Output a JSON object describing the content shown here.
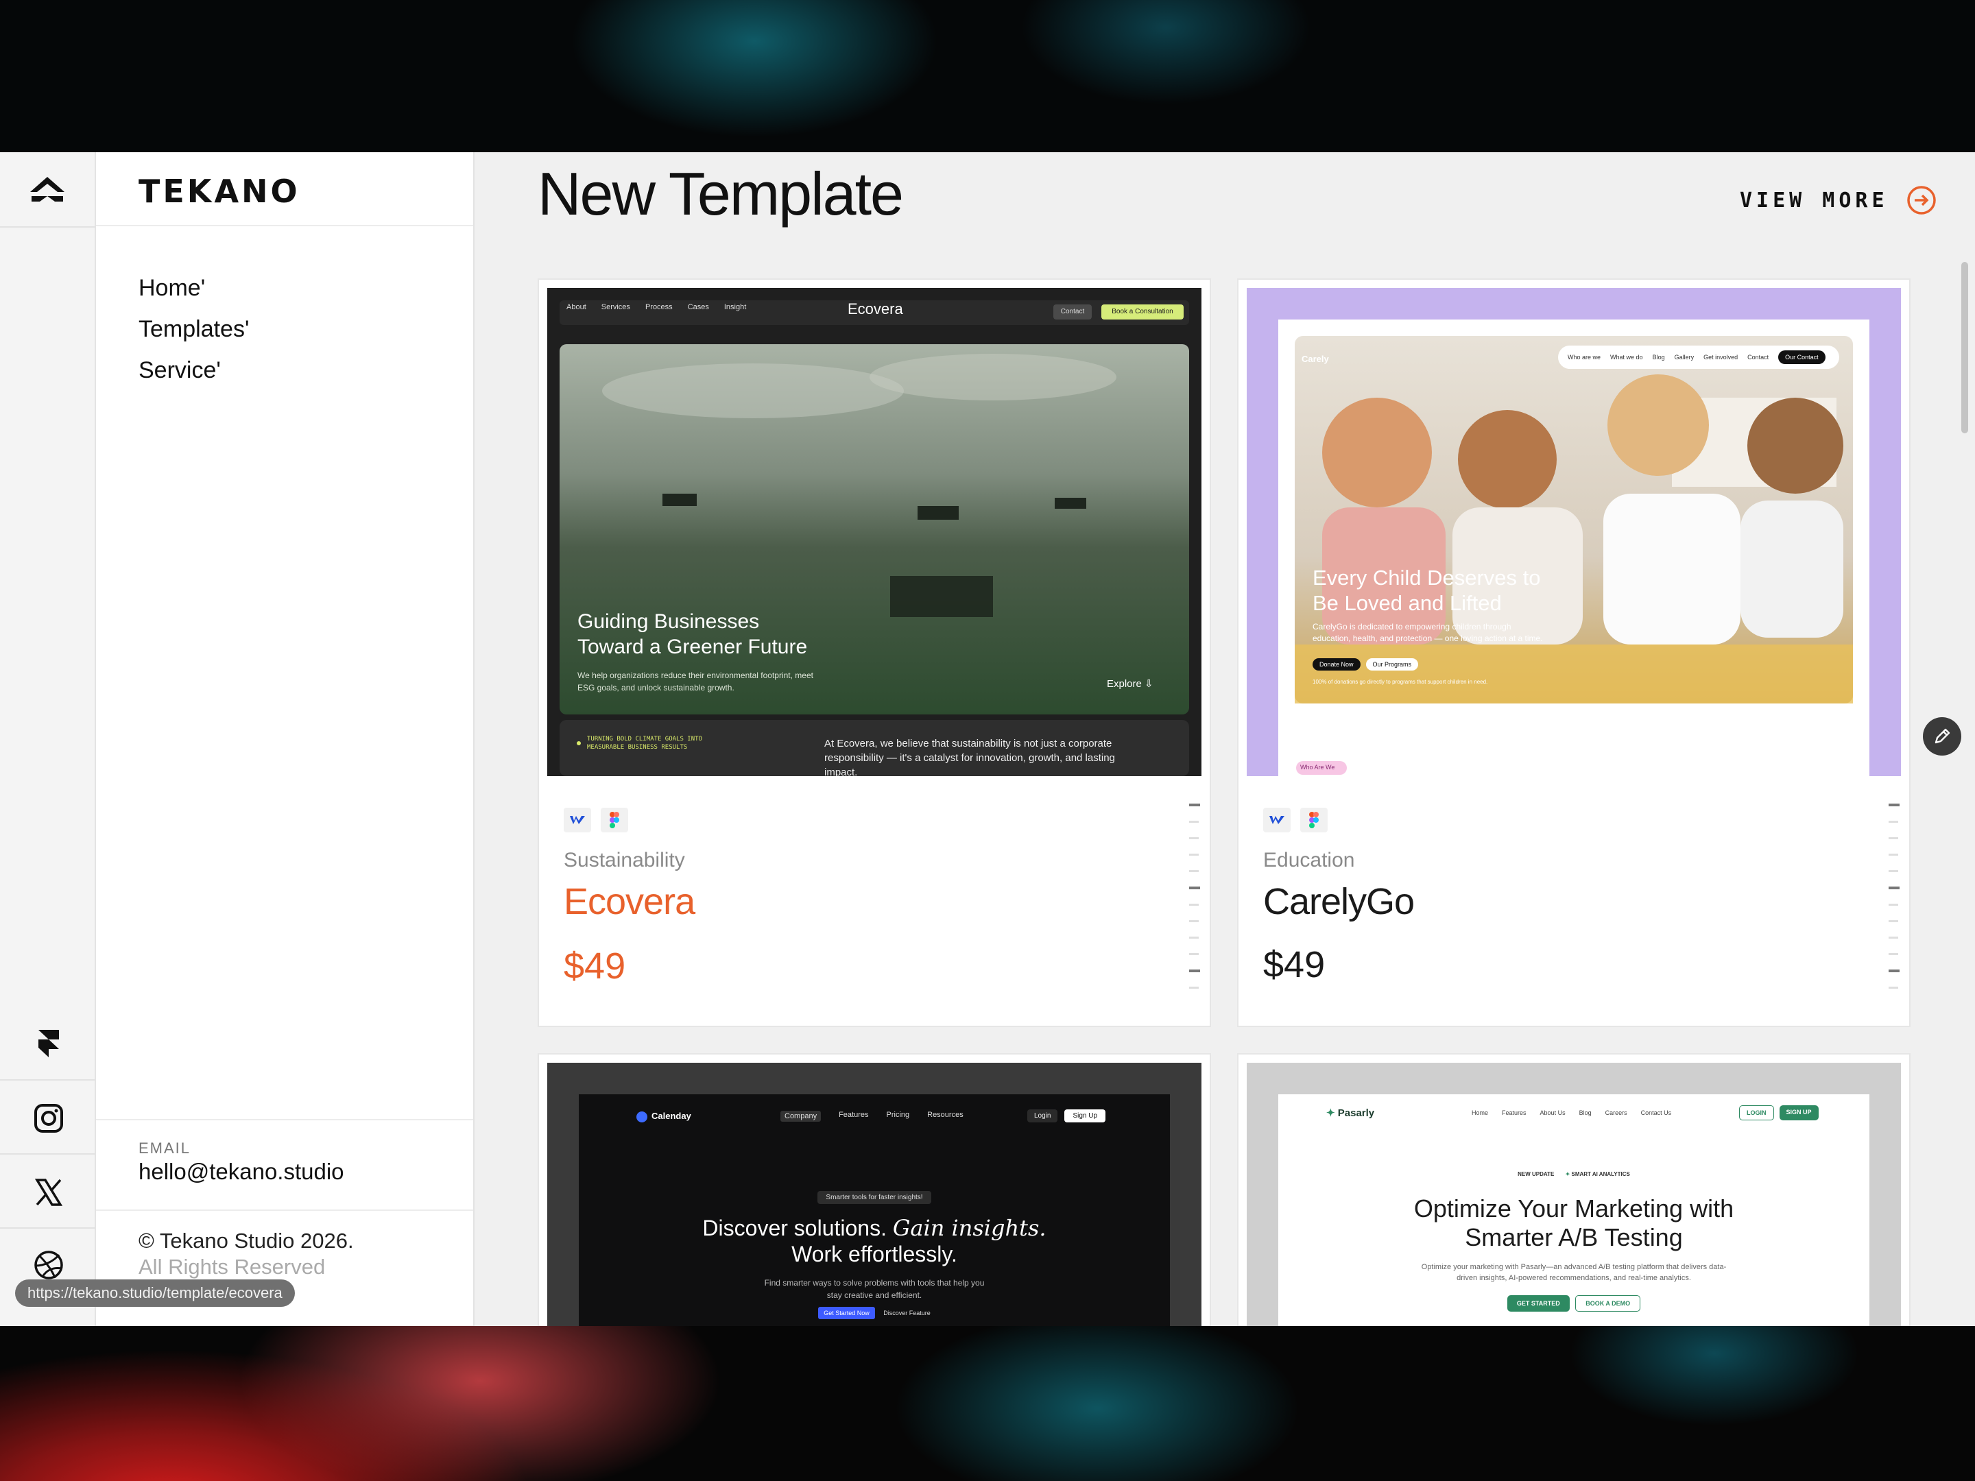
{
  "brand": {
    "name": "TEKANO"
  },
  "nav": [
    {
      "label": "Home'"
    },
    {
      "label": "Templates'"
    },
    {
      "label": "Service'"
    }
  ],
  "footer": {
    "email_label": "EMAIL",
    "email": "hello@tekano.studio",
    "copyright_line1": "© Tekano Studio 2026.",
    "copyright_line2": "All Rights Reserved"
  },
  "rail_icons": [
    "tekano-logo-icon",
    "framer-icon",
    "instagram-icon",
    "x-icon",
    "dribbble-icon"
  ],
  "main": {
    "title": "New Template",
    "view_more": "VIEW MORE"
  },
  "colors": {
    "accent": "#e8612c",
    "ecovera_green": "#2f4a33",
    "carelygo_lilac": "#c5b3ee"
  },
  "cards": [
    {
      "category": "Sustainability",
      "name": "Ecovera",
      "price": "$49",
      "tools": [
        "webflow-icon",
        "figma-icon"
      ],
      "preview": {
        "nav": [
          "About",
          "Services",
          "Process",
          "Cases",
          "Insight"
        ],
        "logo": "Ecovera",
        "contact": "Contact",
        "cta": "Book a Consultation",
        "headline1": "Guiding Businesses",
        "headline2": "Toward a Greener Future",
        "sub1": "We help organizations reduce their environmental footprint, meet",
        "sub2": "ESG goals, and unlock sustainable growth.",
        "explore": "Explore",
        "strip_left1": "TURNING BOLD CLIMATE GOALS INTO",
        "strip_left2": "MEASURABLE BUSINESS RESULTS",
        "strip_right1": "At Ecovera, we believe that sustainability is not just a corporate",
        "strip_right2": "responsibility — it's a catalyst for innovation, growth, and lasting",
        "strip_right3": "impact."
      }
    },
    {
      "category": "Education",
      "name": "CarelyGo",
      "price": "$49",
      "tools": [
        "webflow-icon",
        "figma-icon"
      ],
      "preview": {
        "logo": "Carely",
        "nav": [
          "Who are we",
          "What we do",
          "Blog",
          "Gallery",
          "Get involved",
          "Contact"
        ],
        "cta": "Our Contact",
        "headline1": "Every Child Deserves to",
        "headline2": "Be Loved and Lifted",
        "sub1": "CarelyGo is dedicated to empowering children through",
        "sub2": "education, health, and protection — one loving action at a time.",
        "donate": "Donate Now",
        "programs": "Our Programs",
        "fine": "100% of donations go directly to programs that support children in need.",
        "who_tag": "Who Are We"
      }
    },
    {
      "preview": {
        "logo": "Calenday",
        "nav": [
          "Company",
          "Features",
          "Pricing",
          "Resources"
        ],
        "login": "Login",
        "signup": "Sign Up",
        "pill": "Smarter tools for faster insights!",
        "headline1a": "Discover solutions.",
        "headline1b": "Gain insights.",
        "headline2": "Work effortlessly.",
        "sub1": "Find smarter ways to solve problems with tools that help you",
        "sub2": "stay creative and efficient.",
        "cta1": "Get Started Now",
        "cta2": "Discover Feature"
      }
    },
    {
      "preview": {
        "logo": "Pasarly",
        "nav": [
          "Home",
          "Features",
          "About Us",
          "Blog",
          "Careers",
          "Contact Us"
        ],
        "login": "LOGIN",
        "signup": "SIGN UP",
        "tag1": "NEW UPDATE",
        "tag2": "SMART AI ANALYTICS",
        "headline1": "Optimize Your Marketing with",
        "headline2": "Smarter A/B Testing",
        "sub1": "Optimize your marketing with Pasarly—an advanced A/B testing platform that delivers data-",
        "sub2": "driven insights, AI-powered recommendations, and real-time analytics.",
        "cta1": "GET STARTED",
        "cta2": "BOOK A DEMO"
      }
    }
  ],
  "status_url": "https://tekano.studio/template/ecovera"
}
